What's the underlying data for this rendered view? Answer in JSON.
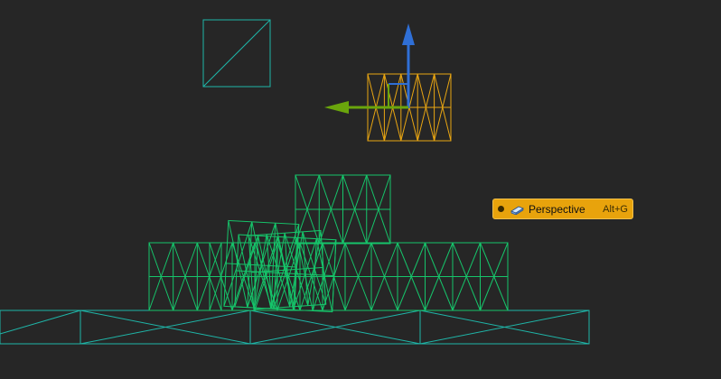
{
  "menu": {
    "items": [
      {
        "label": "Perspective",
        "shortcut": "Alt+G",
        "icon": "perspective-cube-icon",
        "selected": true
      }
    ]
  },
  "colors": {
    "background": "#262626",
    "wire_static": "#1fb5a8",
    "wire_dynamic": "#16c46a",
    "wire_selected": "#e8a512",
    "gizmo_z": "#2f6fd6",
    "gizmo_x": "#6aa50c",
    "menu_highlight": "#e8a30c"
  }
}
